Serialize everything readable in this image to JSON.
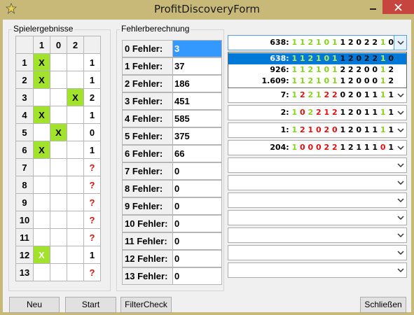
{
  "window": {
    "title": "ProfitDiscoveryForm"
  },
  "left_group": {
    "title": "Spielergebnisse",
    "headers": [
      "1",
      "0",
      "2",
      ""
    ],
    "rows": [
      {
        "no": "1",
        "c1": "X",
        "c0": "",
        "c2": "",
        "res": "1"
      },
      {
        "no": "2",
        "c1": "X",
        "c0": "",
        "c2": "",
        "res": "1"
      },
      {
        "no": "3",
        "c1": "",
        "c0": "",
        "c2": "X",
        "res": "2"
      },
      {
        "no": "4",
        "c1": "X",
        "c0": "",
        "c2": "",
        "res": "1"
      },
      {
        "no": "5",
        "c1": "",
        "c0": "X",
        "c2": "",
        "res": "0"
      },
      {
        "no": "6",
        "c1": "X",
        "c0": "",
        "c2": "",
        "res": "1"
      },
      {
        "no": "7",
        "c1": "",
        "c0": "",
        "c2": "",
        "res": "?"
      },
      {
        "no": "8",
        "c1": "",
        "c0": "",
        "c2": "",
        "res": "?"
      },
      {
        "no": "9",
        "c1": "",
        "c0": "",
        "c2": "",
        "res": "?"
      },
      {
        "no": "10",
        "c1": "",
        "c0": "",
        "c2": "",
        "res": "?"
      },
      {
        "no": "11",
        "c1": "",
        "c0": "",
        "c2": "",
        "res": "?"
      },
      {
        "no": "12",
        "c1": "X",
        "c0": "",
        "c2": "",
        "res": "1"
      },
      {
        "no": "13",
        "c1": "",
        "c0": "",
        "c2": "",
        "res": "?"
      }
    ]
  },
  "middle_group": {
    "title": "Fehlerberechnung",
    "rows": [
      {
        "label": "0 Fehler:",
        "value": "3",
        "selected": true
      },
      {
        "label": "1 Fehler:",
        "value": "37"
      },
      {
        "label": "2 Fehler:",
        "value": "186"
      },
      {
        "label": "3 Fehler:",
        "value": "451"
      },
      {
        "label": "4 Fehler:",
        "value": "585"
      },
      {
        "label": "5 Fehler:",
        "value": "375"
      },
      {
        "label": "6 Fehler:",
        "value": "66"
      },
      {
        "label": "7 Fehler:",
        "value": "0"
      },
      {
        "label": "8 Fehler:",
        "value": "0"
      },
      {
        "label": "9 Fehler:",
        "value": "0"
      },
      {
        "label": "10 Fehler:",
        "value": "0"
      },
      {
        "label": "11 Fehler:",
        "value": "0"
      },
      {
        "label": "12 Fehler:",
        "value": "0"
      },
      {
        "label": "13 Fehler:",
        "value": "0"
      }
    ]
  },
  "dropdowns": [
    {
      "text": "638:  1 1 2 1 0 1 1 2 0 2 2 1 0",
      "open": true
    },
    {
      "text": ""
    },
    {
      "text": ""
    },
    {
      "text": "7:  1 2 2 1 2 2 0 2 0 1 1 1 1"
    },
    {
      "text": "2:  1 0 2 2 1 2 1 2 0 1 1 1 1"
    },
    {
      "text": "1:  1 2 1 0 2 0 1 2 0 1 1 1 1"
    },
    {
      "text": "204:  1 0 0 0 2 2 1 2 1 1 1 0 1"
    },
    {
      "text": ""
    },
    {
      "text": ""
    },
    {
      "text": ""
    },
    {
      "text": ""
    },
    {
      "text": ""
    },
    {
      "text": ""
    },
    {
      "text": ""
    }
  ],
  "dropdown_list": [
    {
      "text": "638:  1 1 2 1 0 1 1 2 0 2 2 1 0",
      "highlighted": true
    },
    {
      "text": "926:  1 1 2 1 0 1 2 2 2 0 0 1 2"
    },
    {
      "text": "1.609:  1 1 2 1 0 1 1 2 0 0 0 1 2"
    }
  ],
  "buttons": {
    "neu": "Neu",
    "start": "Start",
    "filtercheck": "FilterCheck",
    "schliessen": "Schließen"
  },
  "colors": {
    "match_green": "#a1e32a",
    "digit_green": "#86d31b",
    "digit_red": "#e01010",
    "selection_blue": "#3399ff",
    "close_red": "#c7453f"
  }
}
